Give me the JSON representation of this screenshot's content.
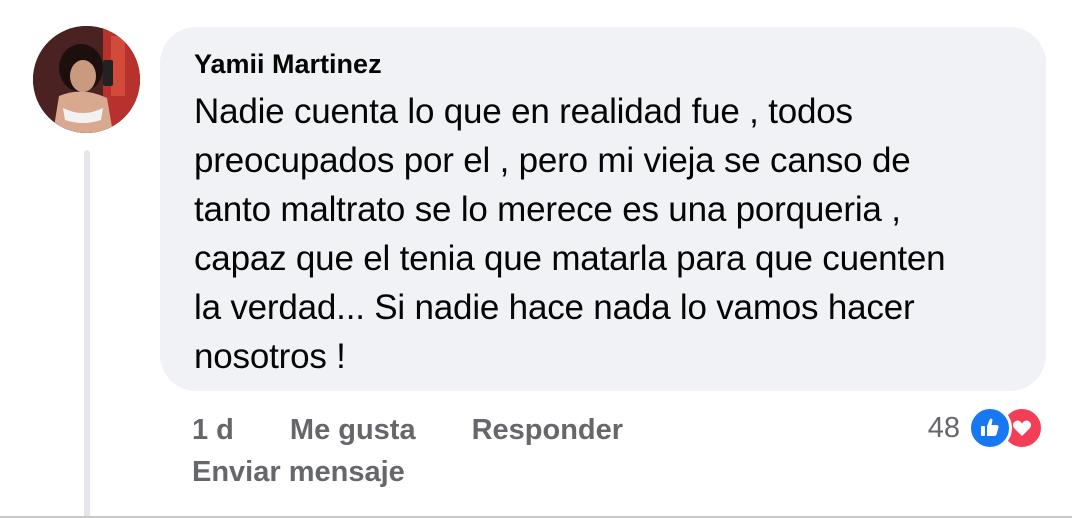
{
  "comment": {
    "author": "Yamii Martinez",
    "text": "Nadie cuenta lo que en realidad fue , todos\npreocupados por el , pero mi vieja se canso de\ntanto maltrato se lo merece es una porqueria ,\ncapaz que el tenia que matarla para que cuenten\nla verdad... Si nadie hace nada lo vamos hacer\nnosotros !",
    "time": "1 d",
    "like_label": "Me gusta",
    "reply_label": "Responder",
    "send_message_label": "Enviar mensaje",
    "reaction_count": "48",
    "reactions": [
      "like-icon",
      "love-icon"
    ]
  },
  "colors": {
    "bubble_bg": "#f0f2f5",
    "meta_text": "#65676b",
    "like_blue": "#1877f2",
    "love_red": "#f33e58"
  }
}
